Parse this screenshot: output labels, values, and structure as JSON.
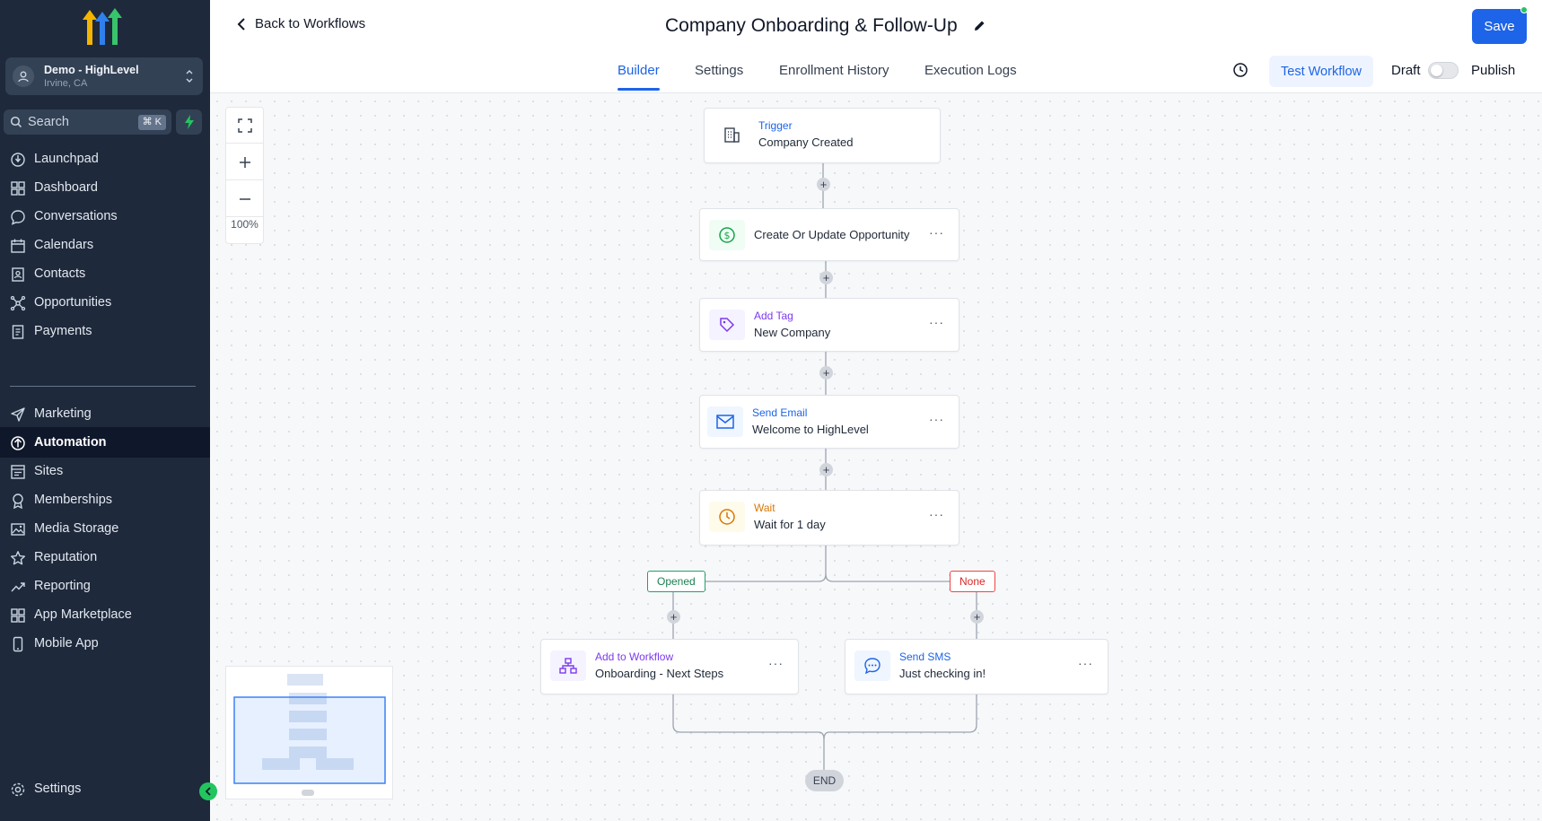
{
  "colors": {
    "sidebar_bg": "#1e293b",
    "accent": "#1d64e8",
    "success": "#22c55e",
    "danger": "#ef4444"
  },
  "sidebar": {
    "account": {
      "name": "Demo - HighLevel",
      "location": "Irvine, CA"
    },
    "search": {
      "placeholder": "Search",
      "shortcut": "⌘ K"
    },
    "items": [
      {
        "label": "Launchpad",
        "icon": "launchpad-icon"
      },
      {
        "label": "Dashboard",
        "icon": "dashboard-icon"
      },
      {
        "label": "Conversations",
        "icon": "chat-icon"
      },
      {
        "label": "Calendars",
        "icon": "calendar-icon"
      },
      {
        "label": "Contacts",
        "icon": "contacts-icon"
      },
      {
        "label": "Opportunities",
        "icon": "opportunities-icon"
      },
      {
        "label": "Payments",
        "icon": "payments-icon"
      },
      {
        "label": "Marketing",
        "icon": "send-icon"
      },
      {
        "label": "Automation",
        "icon": "automation-icon",
        "active": true
      },
      {
        "label": "Sites",
        "icon": "sites-icon"
      },
      {
        "label": "Memberships",
        "icon": "memberships-icon"
      },
      {
        "label": "Media Storage",
        "icon": "media-icon"
      },
      {
        "label": "Reputation",
        "icon": "star-icon"
      },
      {
        "label": "Reporting",
        "icon": "reporting-icon"
      },
      {
        "label": "App Marketplace",
        "icon": "marketplace-icon"
      },
      {
        "label": "Mobile App",
        "icon": "mobile-icon"
      }
    ],
    "settings_label": "Settings"
  },
  "header": {
    "back_label": "Back to Workflows",
    "title": "Company Onboarding & Follow-Up",
    "save_label": "Save",
    "tabs": [
      "Builder",
      "Settings",
      "Enrollment History",
      "Execution Logs"
    ],
    "active_tab": "Builder",
    "test_label": "Test Workflow",
    "draft_label": "Draft",
    "publish_label": "Publish"
  },
  "canvas": {
    "zoom": "100%",
    "trigger": {
      "type": "Trigger",
      "label": "Company Created"
    },
    "steps": [
      {
        "type": "",
        "label": "Create Or Update Opportunity",
        "icon": "dollar-icon",
        "color": "#16a34a"
      },
      {
        "type": "Add Tag",
        "label": "New Company",
        "icon": "tag-icon",
        "color": "#7c3aed"
      },
      {
        "type": "Send Email",
        "label": "Welcome to HighLevel",
        "icon": "mail-icon",
        "color": "#1d64e8"
      },
      {
        "type": "Wait",
        "label": "Wait for 1 day",
        "icon": "clock-icon",
        "color": "#d97706"
      }
    ],
    "branches": {
      "opened": "Opened",
      "none": "None"
    },
    "left_branch": {
      "type": "Add to Workflow",
      "label": "Onboarding - Next Steps",
      "icon": "workflow-icon",
      "color": "#7c3aed"
    },
    "right_branch": {
      "type": "Send SMS",
      "label": "Just checking in!",
      "icon": "sms-icon",
      "color": "#1d64e8"
    },
    "end_label": "END",
    "menu_glyph": "···",
    "plus_glyph": "+"
  }
}
